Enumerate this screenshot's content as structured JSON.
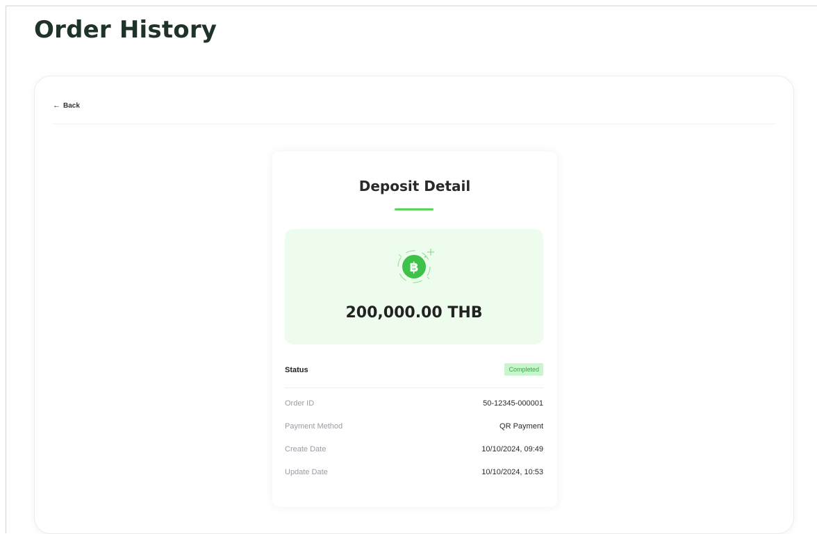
{
  "page": {
    "title": "Order History"
  },
  "nav": {
    "back_label": "Back"
  },
  "detail": {
    "title": "Deposit Detail",
    "amount": "200,000.00 THB",
    "currency_icon": "baht-coin-icon",
    "status_label": "Status",
    "status_value": "Completed",
    "rows": [
      {
        "label": "Order ID",
        "value": "50-12345-000001"
      },
      {
        "label": "Payment Method",
        "value": "QR Payment"
      },
      {
        "label": "Create Date",
        "value": "10/10/2024, 09:49"
      },
      {
        "label": "Update Date",
        "value": "10/10/2024, 10:53"
      }
    ]
  },
  "colors": {
    "accent": "#5cd35a",
    "amount_bg": "#eefcee",
    "coin": "#3fc24a",
    "badge_bg": "#c9f5cd",
    "badge_text": "#3aa54a"
  }
}
